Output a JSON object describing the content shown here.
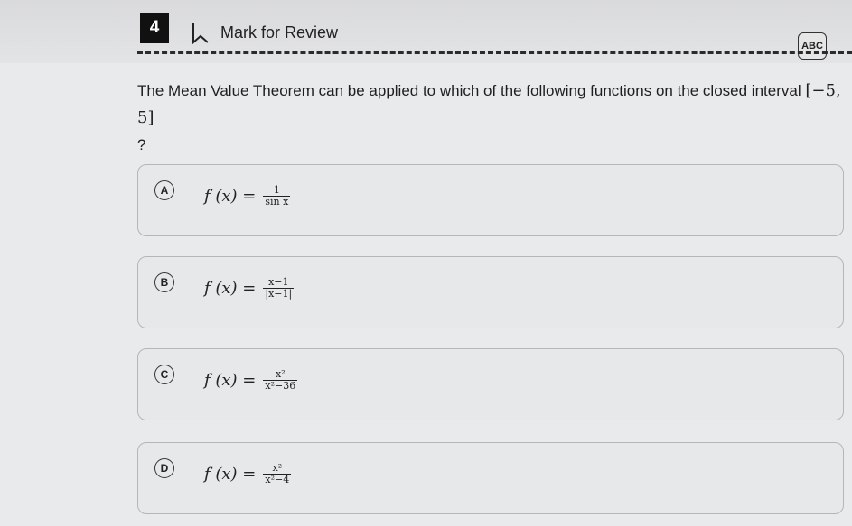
{
  "header": {
    "question_number": "4",
    "mark_for_review_label": "Mark for Review",
    "abc_tool_label": "ABC"
  },
  "question": {
    "text": "The Mean Value Theorem can be applied to which of the following functions on the closed interval",
    "interval": "[−5, 5]",
    "trailing": "?"
  },
  "choices": [
    {
      "letter": "A",
      "lhs": "f (x) =",
      "numerator": "1",
      "denominator": "sin x"
    },
    {
      "letter": "B",
      "lhs": "f (x) =",
      "numerator": "x−1",
      "denominator": "|x−1|"
    },
    {
      "letter": "C",
      "lhs": "f (x) =",
      "numerator": "x²",
      "denominator": "x²−36"
    },
    {
      "letter": "D",
      "lhs": "f (x) =",
      "numerator": "x²",
      "denominator": "x²−4"
    }
  ],
  "colors": {
    "background": "#e9eaec",
    "question_badge": "#111111",
    "border": "#b5b6b9"
  }
}
